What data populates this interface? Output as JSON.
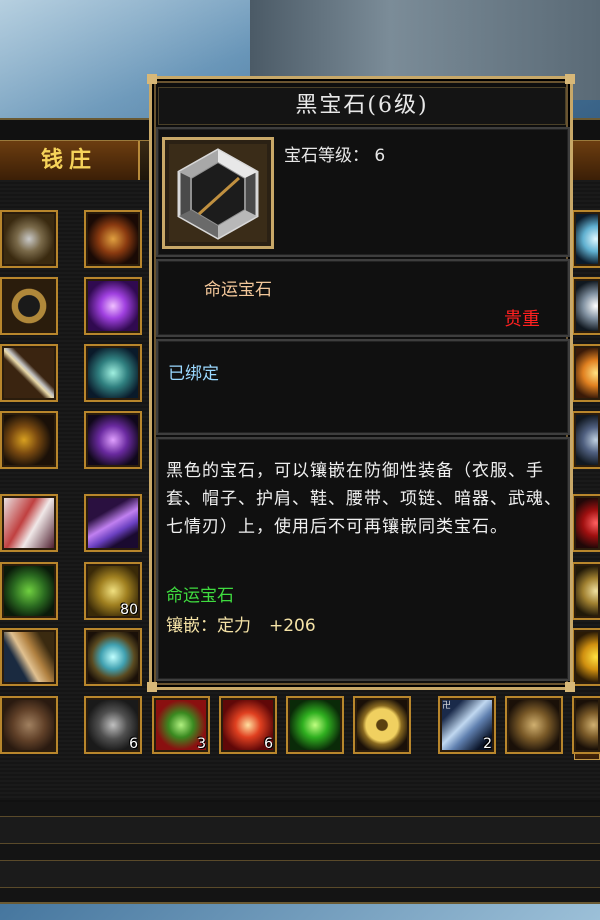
{
  "bank": {
    "title": "钱庄",
    "slot_counts": {
      "r1c2": "80",
      "r8c2": "6",
      "q1": "3",
      "q2": "6",
      "q5": "2"
    }
  },
  "tooltip": {
    "title": "黑宝石(6级)",
    "gem_level_label": "宝石等级：",
    "gem_level_value": "6",
    "type_name": "命运宝石",
    "quality": "贵重",
    "binding": "已绑定",
    "description": "黑色的宝石，可以镶嵌在防御性装备（衣服、手套、帽子、护肩、鞋、腰带、项链、暗器、武魂、七情刃）上，使用后不可再镶嵌同类宝石。",
    "type_name_green": "命运宝石",
    "inlay_label": "镶嵌：定力",
    "inlay_value": "+206"
  },
  "colors": {
    "border_gold": "#c8a868",
    "quality_red": "#ff2020",
    "bound_cyan": "#9ad8ff",
    "type_green": "#3fdc3f"
  }
}
